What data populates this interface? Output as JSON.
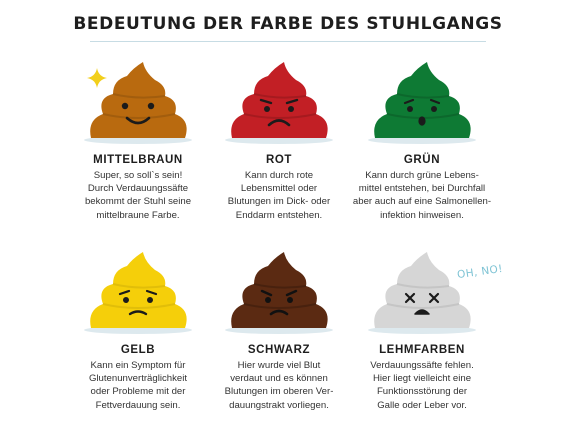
{
  "title": "BEDEUTUNG DER FARBE DES STUHLGANGS",
  "items": [
    {
      "name": "MITTELBRAUN",
      "text": "Super, so soll`s sein!\nDurch Verdauungssäfte\nbekommt der Stuhl seine\nmittelbraune Farbe.",
      "color": "#b96a0f",
      "face": "happy"
    },
    {
      "name": "ROT",
      "text": "Kann durch rote\nLebensmittel oder\nBlutungen im Dick- oder\nEnddarm entstehen.",
      "color": "#c21f25",
      "face": "frown"
    },
    {
      "name": "GRÜN",
      "text": "Kann durch grüne Lebens-\nmittel entstehen, bei Durchfall\naber auch auf eine Salmonellen-\ninfektion hinweisen.",
      "color": "#0e7a34",
      "face": "worried"
    },
    {
      "name": "GELB",
      "text": "Kann ein Symptom für\nGlutenunverträglichkeit\noder Probleme mit der\nFettverdauung sein.",
      "color": "#f5cf0a",
      "face": "sad"
    },
    {
      "name": "SCHWARZ",
      "text": "Hier wurde viel Blut\nverdaut und es können\nBlutungen im oberen Ver-\ndauungstrakt vorliegen.",
      "color": "#5b2a12",
      "face": "angry"
    },
    {
      "name": "LEHMFARBEN",
      "text": "Verdauungssäfte fehlen.\nHier liegt vielleicht eine\nFunktionsstörung der\nGalle oder Leber vor.",
      "color": "#d6d6d6",
      "face": "dead"
    }
  ],
  "exclamation": "OH, NO!"
}
